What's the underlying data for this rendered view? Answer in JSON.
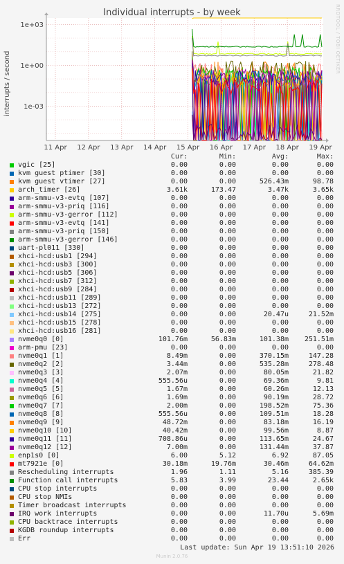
{
  "chart_data": {
    "type": "line",
    "title": "Individual interrupts - by week",
    "ylabel": "interrupts / second",
    "yscale": "log",
    "yticks": [
      "1e+03",
      "1e+00",
      "1e-03"
    ],
    "ytick_values": [
      1000,
      1,
      0.001
    ],
    "ylim": [
      3e-06,
      3000
    ],
    "xticks": [
      "11 Apr",
      "12 Apr",
      "13 Apr",
      "14 Apr",
      "15 Apr",
      "16 Apr",
      "17 Apr",
      "18 Apr",
      "19 Apr"
    ],
    "data_start": "15 Apr",
    "grid": true,
    "columns": [
      "Cur:",
      "Min:",
      "Avg:",
      "Max:"
    ],
    "series": [
      {
        "name": "vgic [25]",
        "color": "#00cc00",
        "cur": "0.00",
        "min": "0.00",
        "avg": "0.00",
        "max": "0.00",
        "level": null
      },
      {
        "name": "kvm guest ptimer [30]",
        "color": "#0066b3",
        "cur": "0.00",
        "min": "0.00",
        "avg": "0.00",
        "max": "0.00",
        "level": null
      },
      {
        "name": "kvm guest vtimer [27]",
        "color": "#ff8000",
        "cur": "0.00",
        "min": "0.00",
        "avg": "526.43m",
        "max": "98.78",
        "level": 0.5
      },
      {
        "name": "arch_timer [26]",
        "color": "#ffcc00",
        "cur": "3.61k",
        "min": "173.47",
        "avg": "3.47k",
        "max": "3.65k",
        "level": 3470
      },
      {
        "name": "arm-smmu-v3-evtq [107]",
        "color": "#330099",
        "cur": "0.00",
        "min": "0.00",
        "avg": "0.00",
        "max": "0.00",
        "level": null
      },
      {
        "name": "arm-smmu-v3-priq [116]",
        "color": "#990099",
        "cur": "0.00",
        "min": "0.00",
        "avg": "0.00",
        "max": "0.00",
        "level": null
      },
      {
        "name": "arm-smmu-v3-gerror [112]",
        "color": "#ccff00",
        "cur": "0.00",
        "min": "0.00",
        "avg": "0.00",
        "max": "0.00",
        "level": null
      },
      {
        "name": "arm-smmu-v3-evtq [141]",
        "color": "#ff0000",
        "cur": "0.00",
        "min": "0.00",
        "avg": "0.00",
        "max": "0.00",
        "level": null
      },
      {
        "name": "arm-smmu-v3-priq [150]",
        "color": "#808080",
        "cur": "0.00",
        "min": "0.00",
        "avg": "0.00",
        "max": "0.00",
        "level": null
      },
      {
        "name": "arm-smmu-v3-gerror [146]",
        "color": "#008f00",
        "cur": "0.00",
        "min": "0.00",
        "avg": "0.00",
        "max": "0.00",
        "level": null
      },
      {
        "name": "uart-pl011 [330]",
        "color": "#00487d",
        "cur": "0.00",
        "min": "0.00",
        "avg": "0.00",
        "max": "0.00",
        "level": null
      },
      {
        "name": "xhci-hcd:usb1 [294]",
        "color": "#b35a00",
        "cur": "0.00",
        "min": "0.00",
        "avg": "0.00",
        "max": "0.00",
        "level": null
      },
      {
        "name": "xhci-hcd:usb3 [300]",
        "color": "#b38f00",
        "cur": "0.00",
        "min": "0.00",
        "avg": "0.00",
        "max": "0.00",
        "level": null
      },
      {
        "name": "xhci-hcd:usb5 [306]",
        "color": "#6b006b",
        "cur": "0.00",
        "min": "0.00",
        "avg": "0.00",
        "max": "0.00",
        "level": null
      },
      {
        "name": "xhci-hcd:usb7 [312]",
        "color": "#8fb300",
        "cur": "0.00",
        "min": "0.00",
        "avg": "0.00",
        "max": "0.00",
        "level": null
      },
      {
        "name": "xhci-hcd:usb9 [284]",
        "color": "#b30000",
        "cur": "0.00",
        "min": "0.00",
        "avg": "0.00",
        "max": "0.00",
        "level": null
      },
      {
        "name": "xhci-hcd:usb11 [289]",
        "color": "#bebebe",
        "cur": "0.00",
        "min": "0.00",
        "avg": "0.00",
        "max": "0.00",
        "level": null
      },
      {
        "name": "xhci-hcd:usb13 [272]",
        "color": "#80ff80",
        "cur": "0.00",
        "min": "0.00",
        "avg": "0.00",
        "max": "0.00",
        "level": null
      },
      {
        "name": "xhci-hcd:usb14 [275]",
        "color": "#80c9ff",
        "cur": "0.00",
        "min": "0.00",
        "avg": "20.47u",
        "max": "21.52m",
        "level": 2e-05
      },
      {
        "name": "xhci-hcd:usb15 [278]",
        "color": "#ffc080",
        "cur": "0.00",
        "min": "0.00",
        "avg": "0.00",
        "max": "0.00",
        "level": null
      },
      {
        "name": "xhci-hcd:usb16 [281]",
        "color": "#ffe680",
        "cur": "0.00",
        "min": "0.00",
        "avg": "0.00",
        "max": "0.00",
        "level": null
      },
      {
        "name": "nvme0q0 [0]",
        "color": "#aa80ff",
        "cur": "101.76m",
        "min": "56.83m",
        "avg": "101.38m",
        "max": "251.51m",
        "level": 0.1
      },
      {
        "name": "arm-pmu [23]",
        "color": "#ee00cc",
        "cur": "0.00",
        "min": "0.00",
        "avg": "0.00",
        "max": "0.00",
        "level": null
      },
      {
        "name": "nvme0q1 [1]",
        "color": "#ff8080",
        "cur": "8.49m",
        "min": "0.00",
        "avg": "370.15m",
        "max": "147.28",
        "level": 0.37
      },
      {
        "name": "nvme0q2 [2]",
        "color": "#666600",
        "cur": "3.44m",
        "min": "0.00",
        "avg": "535.28m",
        "max": "278.48",
        "level": 0.53
      },
      {
        "name": "nvme0q3 [3]",
        "color": "#ffbfff",
        "cur": "2.07m",
        "min": "0.00",
        "avg": "80.05m",
        "max": "21.82",
        "level": 0.08
      },
      {
        "name": "nvme0q4 [4]",
        "color": "#00ffcc",
        "cur": "555.56u",
        "min": "0.00",
        "avg": "69.36m",
        "max": "9.81",
        "level": 0.069
      },
      {
        "name": "nvme0q5 [5]",
        "color": "#cc6699",
        "cur": "1.67m",
        "min": "0.00",
        "avg": "60.26m",
        "max": "12.13",
        "level": 0.06
      },
      {
        "name": "nvme0q6 [6]",
        "color": "#999900",
        "cur": "1.69m",
        "min": "0.00",
        "avg": "90.19m",
        "max": "28.72",
        "level": 0.09
      },
      {
        "name": "nvme0q7 [7]",
        "color": "#00cc00",
        "cur": "2.00m",
        "min": "0.00",
        "avg": "198.52m",
        "max": "75.36",
        "level": 0.2
      },
      {
        "name": "nvme0q8 [8]",
        "color": "#0066b3",
        "cur": "555.56u",
        "min": "0.00",
        "avg": "109.51m",
        "max": "18.28",
        "level": 0.11
      },
      {
        "name": "nvme0q9 [9]",
        "color": "#ff8000",
        "cur": "48.72m",
        "min": "0.00",
        "avg": "83.18m",
        "max": "16.19",
        "level": 0.083
      },
      {
        "name": "nvme0q10 [10]",
        "color": "#ffcc00",
        "cur": "40.42m",
        "min": "0.00",
        "avg": "99.56m",
        "max": "8.87",
        "level": 0.1
      },
      {
        "name": "nvme0q11 [11]",
        "color": "#330099",
        "cur": "708.86u",
        "min": "0.00",
        "avg": "113.65m",
        "max": "24.67",
        "level": 0.11
      },
      {
        "name": "nvme0q12 [12]",
        "color": "#990099",
        "cur": "7.00m",
        "min": "0.00",
        "avg": "131.44m",
        "max": "37.87",
        "level": 0.13
      },
      {
        "name": "enp1s0 [0]",
        "color": "#ccff00",
        "cur": "6.00",
        "min": "5.12",
        "avg": "6.92",
        "max": "87.05",
        "level": 6.92
      },
      {
        "name": "mt7921e [0]",
        "color": "#ff0000",
        "cur": "30.18m",
        "min": "19.76m",
        "avg": "30.46m",
        "max": "64.62m",
        "level": 0.03
      },
      {
        "name": "Rescheduling interrupts",
        "color": "#808080",
        "cur": "1.96",
        "min": "1.11",
        "avg": "5.16",
        "max": "385.39",
        "level": 5.16
      },
      {
        "name": "Function call interrupts",
        "color": "#008f00",
        "cur": "5.83",
        "min": "3.99",
        "avg": "23.44",
        "max": "2.65k",
        "level": 23.44
      },
      {
        "name": "CPU stop interrupts",
        "color": "#00487d",
        "cur": "0.00",
        "min": "0.00",
        "avg": "0.00",
        "max": "0.00",
        "level": null
      },
      {
        "name": "CPU stop NMIs",
        "color": "#b35a00",
        "cur": "0.00",
        "min": "0.00",
        "avg": "0.00",
        "max": "0.00",
        "level": null
      },
      {
        "name": "Timer broadcast interrupts",
        "color": "#b38f00",
        "cur": "0.00",
        "min": "0.00",
        "avg": "0.00",
        "max": "0.00",
        "level": null
      },
      {
        "name": "IRQ work interrupts",
        "color": "#6b006b",
        "cur": "0.00",
        "min": "0.00",
        "avg": "11.70u",
        "max": "5.69m",
        "level": 1.17e-05
      },
      {
        "name": "CPU backtrace interrupts",
        "color": "#8fb300",
        "cur": "0.00",
        "min": "0.00",
        "avg": "0.00",
        "max": "0.00",
        "level": null
      },
      {
        "name": "KGDB roundup interrupts",
        "color": "#b30000",
        "cur": "0.00",
        "min": "0.00",
        "avg": "0.00",
        "max": "0.00",
        "level": null
      },
      {
        "name": "Err",
        "color": "#bebebe",
        "cur": "0.00",
        "min": "0.00",
        "avg": "0.00",
        "max": "0.00",
        "level": null
      }
    ]
  },
  "footer": {
    "last_update": "Last update: Sun Apr 19 13:51:10 2026",
    "generator": "Munin 2.0.76",
    "side_label": "RRDTOOL / TOBI OETIKER"
  }
}
